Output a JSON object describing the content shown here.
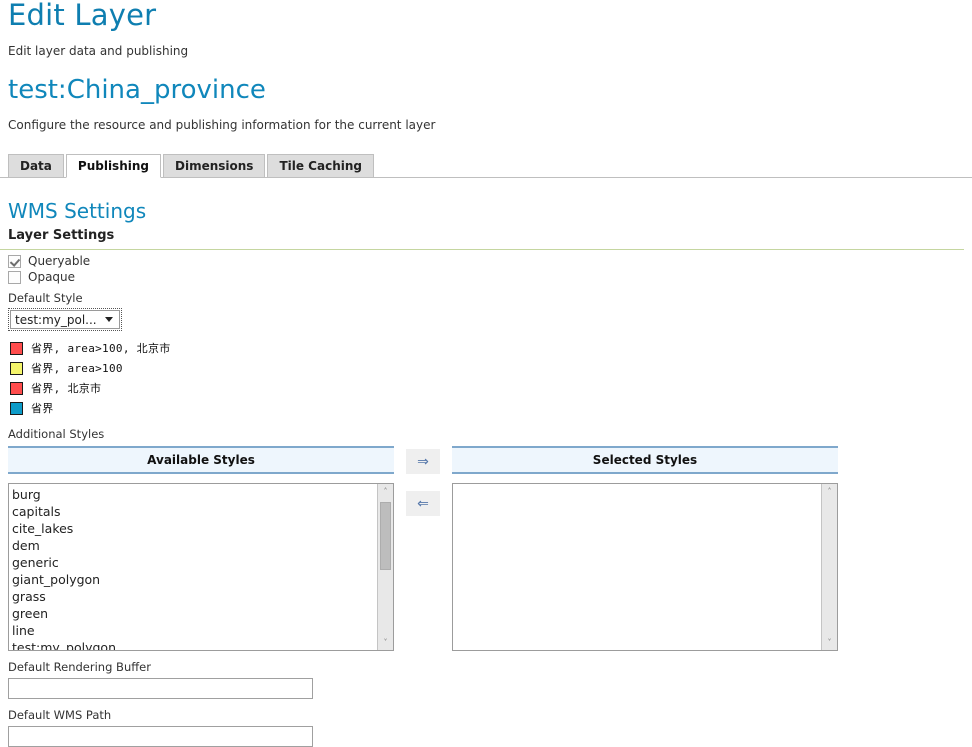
{
  "header": {
    "page_title": "Edit Layer",
    "page_subtitle": "Edit layer data and publishing",
    "resource_title": "test:China_province",
    "resource_subtitle": "Configure the resource and publishing information for the current layer",
    "title_color": "#0E7EB0"
  },
  "tabs": [
    {
      "label": "Data",
      "active": false
    },
    {
      "label": "Publishing",
      "active": true
    },
    {
      "label": "Dimensions",
      "active": false
    },
    {
      "label": "Tile Caching",
      "active": false
    }
  ],
  "wms": {
    "section_title": "WMS Settings",
    "subsection_title": "Layer Settings",
    "checkboxes": [
      {
        "label": "Queryable",
        "checked": true
      },
      {
        "label": "Opaque",
        "checked": false
      }
    ],
    "default_style": {
      "label": "Default Style",
      "value": "test:my_pol...",
      "caret_icon": "chevron-down-icon"
    },
    "legend": [
      {
        "color": "#FF4D4D",
        "text": "省界, area>100, 北京市"
      },
      {
        "color": "#F5F56B",
        "text": "省界, area>100"
      },
      {
        "color": "#FF4D4D",
        "text": "省界, 北京市"
      },
      {
        "color": "#0D9BC8",
        "text": "省界"
      }
    ],
    "additional_styles_label": "Additional Styles",
    "available": {
      "header": "Available Styles",
      "items": [
        "burg",
        "capitals",
        "cite_lakes",
        "dem",
        "generic",
        "giant_polygon",
        "grass",
        "green",
        "line",
        "test:my_polygon"
      ]
    },
    "selected": {
      "header": "Selected Styles",
      "items": []
    },
    "transfer": {
      "add_label": "⇒",
      "remove_label": "⇐",
      "add_icon": "arrow-right-icon",
      "remove_icon": "arrow-left-icon"
    },
    "scroll_up_icon": "˄",
    "scroll_down_icon": "˅",
    "rendering_buffer": {
      "label": "Default Rendering Buffer",
      "value": ""
    },
    "wms_path": {
      "label": "Default WMS Path",
      "value": ""
    }
  }
}
